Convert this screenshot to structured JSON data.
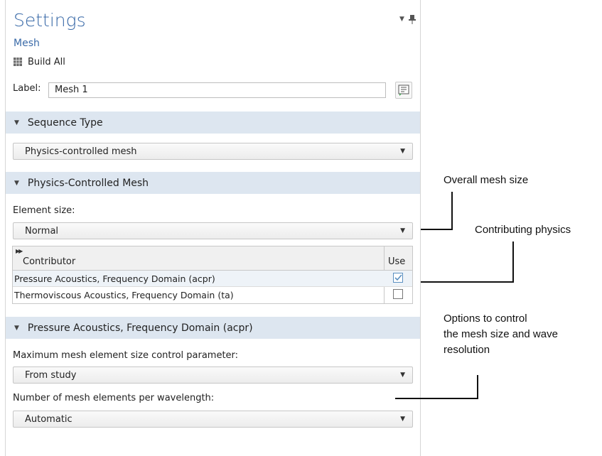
{
  "header": {
    "title": "Settings",
    "subtitle": "Mesh",
    "build_all_label": "Build All"
  },
  "label_field": {
    "label": "Label:",
    "value": "Mesh 1"
  },
  "sections": {
    "sequence_type": {
      "title": "Sequence Type",
      "select_value": "Physics-controlled mesh"
    },
    "physics_controlled": {
      "title": "Physics-Controlled Mesh",
      "element_size_label": "Element size:",
      "element_size_value": "Normal",
      "table": {
        "columns": [
          "Contributor",
          "Use"
        ],
        "rows": [
          {
            "contributor": "Pressure Acoustics, Frequency Domain (acpr)",
            "use": true
          },
          {
            "contributor": "Thermoviscous Acoustics, Frequency Domain (ta)",
            "use": false
          }
        ]
      }
    },
    "pressure_acoustics": {
      "title": "Pressure Acoustics, Frequency Domain (acpr)",
      "max_size_label": "Maximum mesh element size control parameter:",
      "max_size_value": "From study",
      "elements_per_wavelength_label": "Number of mesh elements per wavelength:",
      "elements_per_wavelength_value": "Automatic"
    }
  },
  "annotations": {
    "overall_mesh_size": "Overall mesh size",
    "contributing_physics": "Contributing physics",
    "options_line1": "Options to control",
    "options_line2": "the mesh size and wave",
    "options_line3": "resolution"
  },
  "colors": {
    "title_blue": "#3a6aa8",
    "section_bg": "#dde6f0",
    "check_blue": "#5a8fc0"
  },
  "icons": [
    "build-all-icon",
    "pin-icon",
    "dropdown-arrow-icon",
    "label-edit-icon",
    "expand-triangle-icon",
    "checkbox-icon"
  ]
}
